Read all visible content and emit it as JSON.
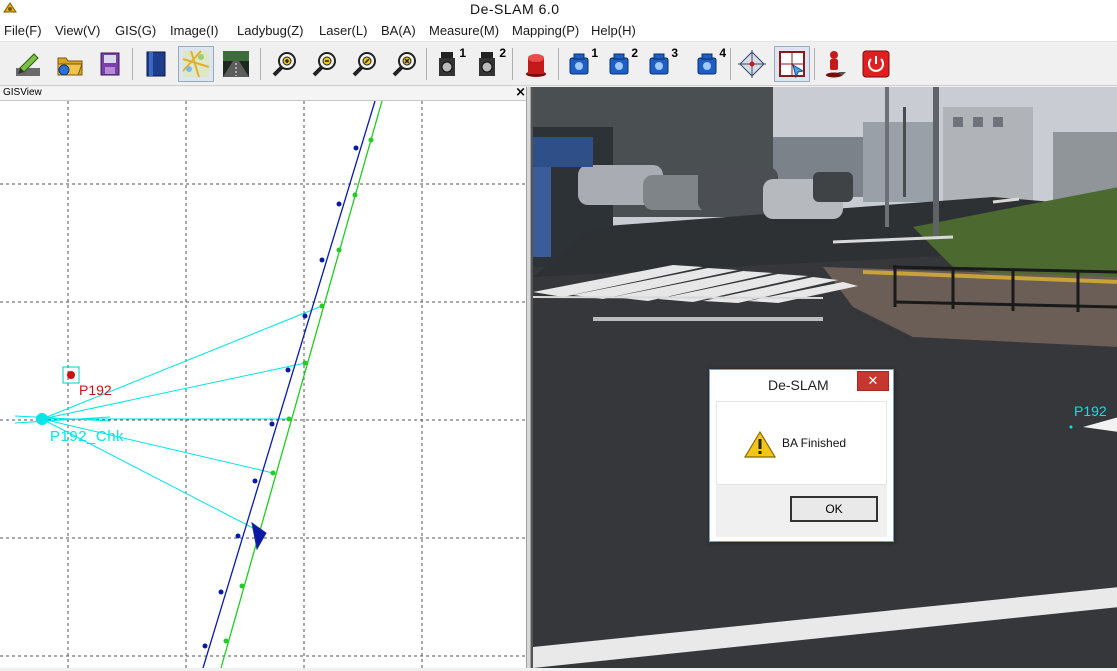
{
  "window": {
    "title": "De-SLAM 6.0"
  },
  "menu": {
    "items": [
      "File(F)",
      "View(V)",
      "GIS(G)",
      "Image(I)",
      "Ladybug(Z)",
      "Laser(L)",
      "BA(A)",
      "Measure(M)",
      "Mapping(P)",
      "Help(H)"
    ]
  },
  "toolbar": {
    "buttons": [
      {
        "name": "pen-tool-icon"
      },
      {
        "name": "open-folder-icon"
      },
      {
        "name": "save-disk-icon"
      },
      {
        "name": "book-icon"
      },
      {
        "name": "map-view-icon"
      },
      {
        "name": "road-image-icon"
      },
      {
        "name": "zoom-in-icon"
      },
      {
        "name": "zoom-out-icon"
      },
      {
        "name": "zoom-fit-icon"
      },
      {
        "name": "zoom-cancel-icon"
      },
      {
        "name": "camera-1-icon",
        "sup": "1"
      },
      {
        "name": "camera-2-icon",
        "sup": "2"
      },
      {
        "name": "red-marker-icon"
      },
      {
        "name": "blue-camera-1-icon",
        "sup": "1"
      },
      {
        "name": "blue-camera-2-icon",
        "sup": "2"
      },
      {
        "name": "blue-camera-3-icon",
        "sup": "3"
      },
      {
        "name": "blue-camera-4-icon",
        "sup": "4"
      },
      {
        "name": "target-crosshair-icon"
      },
      {
        "name": "select-window-icon"
      },
      {
        "name": "person-pin-icon"
      },
      {
        "name": "power-exit-icon"
      }
    ]
  },
  "gis_view": {
    "title": "GISView",
    "close": "×",
    "points": [
      {
        "label": "P192"
      },
      {
        "label": "P192_Chk"
      }
    ]
  },
  "photo_view": {
    "point_label": "P192"
  },
  "dialog": {
    "title": "De-SLAM",
    "close": "✕",
    "message": "BA Finished",
    "ok_label": "OK"
  },
  "colors": {
    "track_blue": "#0a1aa8",
    "track_green": "#22cc22",
    "ray_cyan": "#00e6e6",
    "point_red": "#cc1111",
    "dialog_close": "#c7372f"
  }
}
